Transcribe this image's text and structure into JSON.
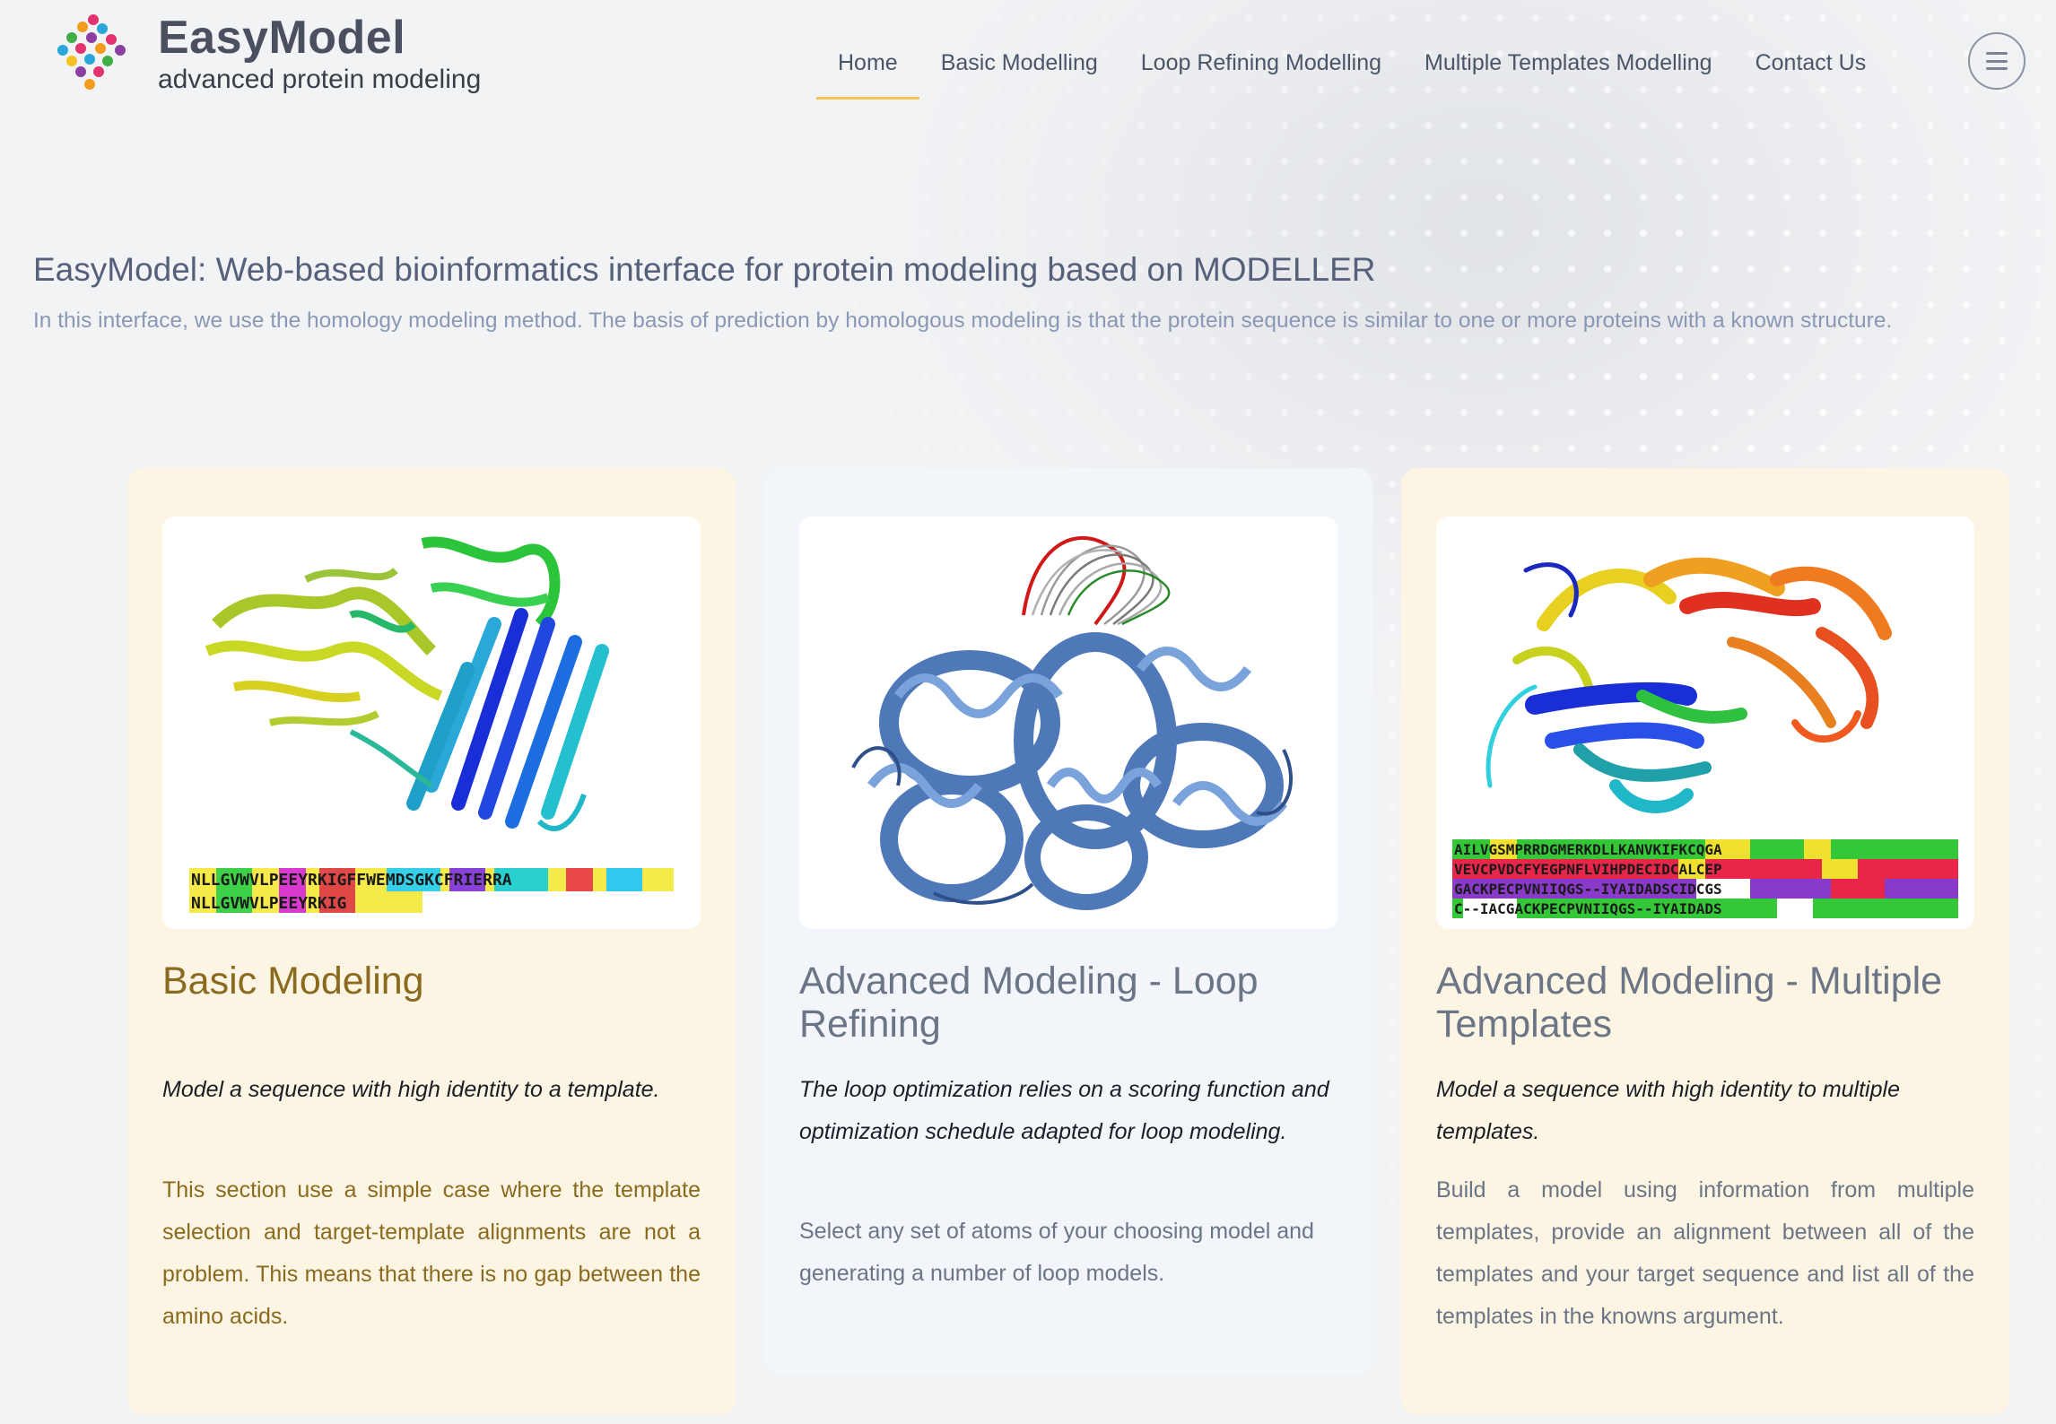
{
  "header": {
    "brand_name": "EasyModel",
    "brand_tagline": "advanced protein modeling",
    "nav": [
      {
        "label": "Home",
        "active": true
      },
      {
        "label": "Basic Modelling",
        "active": false
      },
      {
        "label": "Loop Refining Modelling",
        "active": false
      },
      {
        "label": "Multiple Templates Modelling",
        "active": false
      },
      {
        "label": "Contact Us",
        "active": false
      }
    ],
    "menu_icon": "hamburger-icon",
    "accent_color": "#f0c75a"
  },
  "hero": {
    "title": "EasyModel: Web-based bioinformatics interface for protein modeling based on MODELLER",
    "description": "In this interface, we use the homology modeling method. The basis of prediction by homologous modeling is that the protein sequence is similar to one or more proteins with a known structure."
  },
  "cards": [
    {
      "title": "Basic Modeling",
      "lead": "Model a sequence with high identity to a template.",
      "body": "This section use a simple case where the template selection and target-template alignments are not a problem. This means that there is no gap between the amino acids.",
      "image": "protein-structure-rainbow",
      "sequence_rows": [
        "NLLGVWVLPEEYRKIGFFWEMDSGKCFRIERRA",
        "NLLGVWVLPEEYRKIG"
      ]
    },
    {
      "title": "Advanced Modeling - Loop Refining",
      "lead": "The loop optimization relies on a scoring function and optimization schedule adapted for loop modeling.",
      "body": "Select any set of atoms of your choosing model and generating a number of loop models.",
      "image": "protein-structure-loops"
    },
    {
      "title": "Advanced Modeling - Multiple Templates",
      "lead": "Model a sequence with high identity to multiple templates.",
      "body": "Build a model using information from multiple templates, provide an alignment between all of the templates and your target sequence and list all of the templates in the knowns argument.",
      "image": "protein-structure-multicolor",
      "sequence_rows": [
        "AILVGSMPRRDGMERKDLLKANVKIFKCQGA",
        "VEVCPVDCFYEGPNFLVIHPDECIDCALCEP",
        "GACKPECPVNIIQGS--IYAIDADSCIDCGS",
        "C--IACGACKPECPVNIIQGS--IYAIDADS"
      ]
    }
  ]
}
